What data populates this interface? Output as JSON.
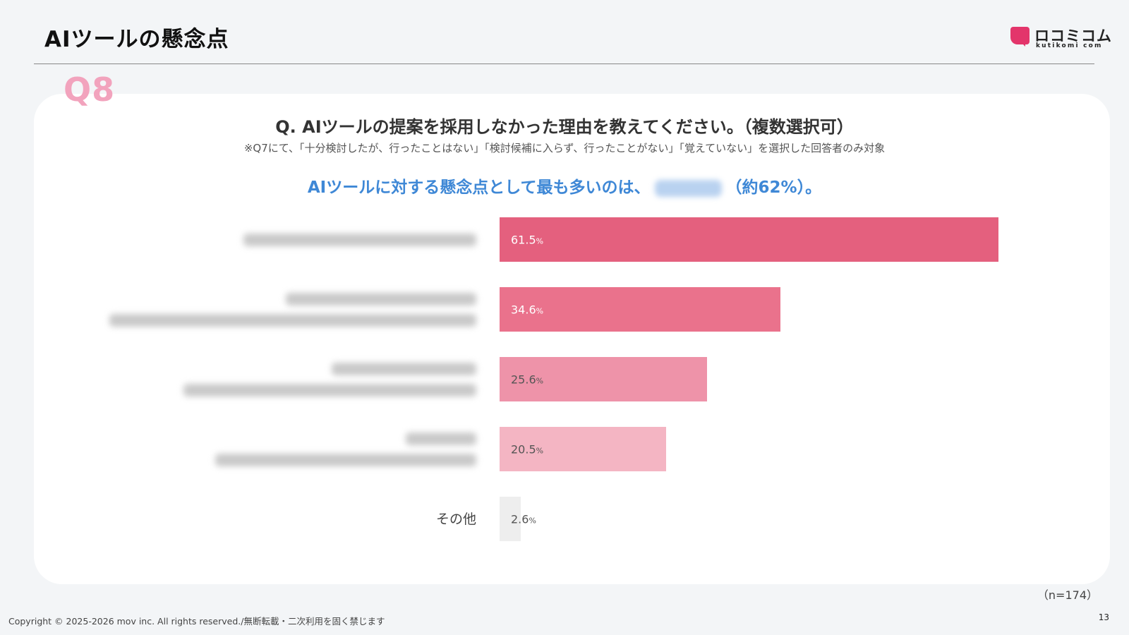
{
  "header": {
    "title": "AIツールの懸念点",
    "logo_text": "ロコミコム",
    "logo_sub": "kutikomi com"
  },
  "question": {
    "badge": "Q8",
    "text": "Q.  AIツールの提案を採用しなかった理由を教えてください。（複数選択可）",
    "note": "※Q7にて、「十分検討したが、行ったことはない」「検討候補に入らず、行ったことがない」「覚えていない」を選択した回答者のみ対象",
    "headline_before": "AIツールに対する懸念点として最も多いのは、",
    "headline_after": "（約62%）。"
  },
  "chart_data": {
    "type": "bar",
    "orientation": "horizontal",
    "categories": [
      "",
      "",
      "",
      "",
      "その他"
    ],
    "values": [
      61.5,
      34.6,
      25.6,
      20.5,
      2.6
    ],
    "value_labels": [
      "61.5",
      "34.6",
      "25.6",
      "20.5",
      "2.6"
    ],
    "unit": "%",
    "colors": [
      "#e4607e",
      "#ea728c",
      "#ee93a9",
      "#f4b5c3",
      "#eeeeee"
    ],
    "value_text_colors": [
      "#ffffff",
      "#ffffff",
      "#555555",
      "#555555",
      "#555555"
    ],
    "xlim": [
      0,
      61.5
    ]
  },
  "footer": {
    "n_label": "（n=174）",
    "copyright": "Copyright © 2025-2026 mov inc. All rights reserved./無断転載・二次利用を固く禁じます",
    "page_number": "13"
  }
}
